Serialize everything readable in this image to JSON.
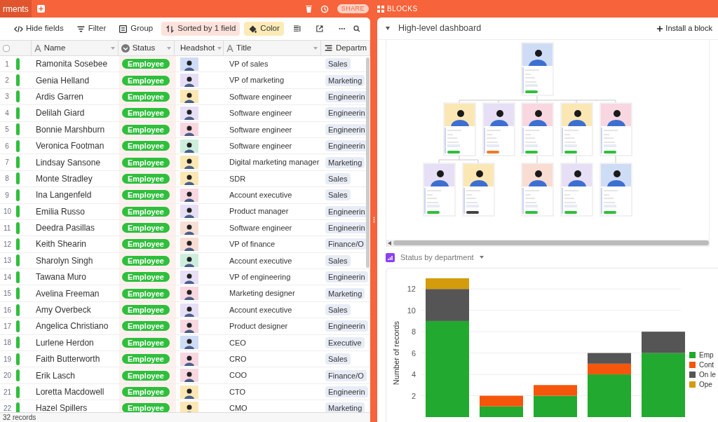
{
  "top_bar": {
    "tab_label": "rments",
    "blocks_label": "BLOCKS",
    "share_label": "SHARE"
  },
  "toolbar": {
    "items": [
      {
        "kind": "hide",
        "label": "Hide fields",
        "active": false
      },
      {
        "kind": "filter",
        "label": "Filter",
        "active": false
      },
      {
        "kind": "group",
        "label": "Group",
        "active": false
      },
      {
        "kind": "sort",
        "label": "Sorted by 1 field",
        "active": true,
        "color": "#fde2dc"
      },
      {
        "kind": "color",
        "label": "Color",
        "active": true,
        "color": "#fcebb6"
      }
    ]
  },
  "table": {
    "all_selected": false,
    "columns": [
      {
        "kind": "text",
        "label": "Name"
      },
      {
        "kind": "status",
        "label": "Status"
      },
      {
        "kind": "file",
        "label": "Headshot"
      },
      {
        "kind": "text",
        "label": "Title"
      },
      {
        "kind": "list",
        "label": "Departm"
      }
    ],
    "rows": [
      {
        "number": "1",
        "color": "#2fbf3c",
        "name": "Ramonita Sosebee",
        "status": "Employee",
        "headshot": {
          "color": "#cfdcf6"
        },
        "title": "VP of sales",
        "department": "Sales"
      },
      {
        "number": "2",
        "color": "#2fbf3c",
        "name": "Genia Helland",
        "status": "Employee",
        "headshot": {
          "color": "#e6dff5"
        },
        "title": "VP of marketing",
        "department": "Marketing"
      },
      {
        "number": "3",
        "color": "#2fbf3c",
        "name": "Ardis Garren",
        "status": "Employee",
        "headshot": {
          "color": "#fbe7b4"
        },
        "title": "Software engineer",
        "department": "Engineerin"
      },
      {
        "number": "4",
        "color": "#2fbf3c",
        "name": "Delilah Giard",
        "status": "Employee",
        "headshot": {
          "color": "#e6dff5"
        },
        "title": "Software engineer",
        "department": "Engineerin"
      },
      {
        "number": "5",
        "color": "#2fbf3c",
        "name": "Bonnie Marshburn",
        "status": "Employee",
        "headshot": {
          "color": "#f8d7e0"
        },
        "title": "Software engineer",
        "department": "Engineerin"
      },
      {
        "number": "6",
        "color": "#2fbf3c",
        "name": "Veronica Footman",
        "status": "Employee",
        "headshot": {
          "color": "#cdeedd"
        },
        "title": "Software engineer",
        "department": "Engineerin"
      },
      {
        "number": "7",
        "color": "#2fbf3c",
        "name": "Lindsay Sansone",
        "status": "Employee",
        "headshot": {
          "color": "#fbe7b4"
        },
        "title": "Digital marketing manager",
        "department": "Marketing"
      },
      {
        "number": "8",
        "color": "#2fbf3c",
        "name": "Monte Stradley",
        "status": "Employee",
        "headshot": {
          "color": "#fbe7b4"
        },
        "title": "SDR",
        "department": "Sales"
      },
      {
        "number": "9",
        "color": "#2fbf3c",
        "name": "Ina Langenfeld",
        "status": "Employee",
        "headshot": {
          "color": "#f8d7e0"
        },
        "title": "Account executive",
        "department": "Sales"
      },
      {
        "number": "10",
        "color": "#2fbf3c",
        "name": "Emilia Russo",
        "status": "Employee",
        "headshot": {
          "color": "#e6dff5"
        },
        "title": "Product manager",
        "department": "Engineerin"
      },
      {
        "number": "11",
        "color": "#2fbf3c",
        "name": "Deedra Pasillas",
        "status": "Employee",
        "headshot": {
          "color": "#f6e0d6"
        },
        "title": "Software engineer",
        "department": "Engineerin"
      },
      {
        "number": "12",
        "color": "#2fbf3c",
        "name": "Keith Shearin",
        "status": "Employee",
        "headshot": {
          "color": "#f9dcd2"
        },
        "title": "VP of finance",
        "department": "Finance/O"
      },
      {
        "number": "13",
        "color": "#2fbf3c",
        "name": "Sharolyn Singh",
        "status": "Employee",
        "headshot": {
          "color": "#cdeedd"
        },
        "title": "Account executive",
        "department": "Sales"
      },
      {
        "number": "14",
        "color": "#2fbf3c",
        "name": "Tawana Muro",
        "status": "Employee",
        "headshot": {
          "color": "#e6dff5"
        },
        "title": "VP of engineering",
        "department": "Engineerin"
      },
      {
        "number": "15",
        "color": "#2fbf3c",
        "name": "Avelina Freeman",
        "status": "Employee",
        "headshot": {
          "color": "#f8d7e0"
        },
        "title": "Marketing designer",
        "department": "Marketing"
      },
      {
        "number": "16",
        "color": "#2fbf3c",
        "name": "Amy Overbeck",
        "status": "Employee",
        "headshot": {
          "color": "#e6dff5"
        },
        "title": "Account executive",
        "department": "Sales"
      },
      {
        "number": "17",
        "color": "#2fbf3c",
        "name": "Angelica Christiano",
        "status": "Employee",
        "headshot": {
          "color": "#f8d7e0"
        },
        "title": "Product designer",
        "department": "Engineerin"
      },
      {
        "number": "18",
        "color": "#2fbf3c",
        "name": "Lurlene Herdon",
        "status": "Employee",
        "headshot": {
          "color": "#cfdcf6"
        },
        "title": "CEO",
        "department": "Executive"
      },
      {
        "number": "19",
        "color": "#2fbf3c",
        "name": "Faith Butterworth",
        "status": "Employee",
        "headshot": {
          "color": "#f8d7e0"
        },
        "title": "CRO",
        "department": "Sales"
      },
      {
        "number": "20",
        "color": "#2fbf3c",
        "name": "Erik Lasch",
        "status": "Employee",
        "headshot": {
          "color": "#f8d7e0"
        },
        "title": "COO",
        "department": "Finance/O"
      },
      {
        "number": "21",
        "color": "#2fbf3c",
        "name": "Loretta Macdowell",
        "status": "Employee",
        "headshot": {
          "color": "#fbe7b4"
        },
        "title": "CTO",
        "department": "Engineerin"
      },
      {
        "number": "22",
        "color": "#2fbf3c",
        "name": "Hazel Spillers",
        "status": "Employee",
        "headshot": {
          "color": "#fbe7b4"
        },
        "title": "CMO",
        "department": "Marketing"
      }
    ],
    "footer": "32 records"
  },
  "dashboard": {
    "title": "High-level dashboard",
    "install_label": "Install a block",
    "chart_block": {
      "title": "Status by department",
      "chart_data": {
        "type": "bar",
        "stacked": true,
        "grid": true,
        "legend": true,
        "ylabel": "Number of records",
        "ylim": [
          0,
          13
        ],
        "yticks": [
          2,
          4,
          6,
          8,
          10,
          12
        ],
        "series": [
          {
            "name": "Emp",
            "color": "#22a92f",
            "values": [
              9,
              1,
              2,
              4,
              6
            ]
          },
          {
            "name": "Cont",
            "color": "#f4560b",
            "values": [
              0,
              1,
              1,
              1,
              0
            ]
          },
          {
            "name": "On le",
            "color": "#555555",
            "values": [
              3,
              0,
              0,
              1,
              2
            ]
          },
          {
            "name": "Ope",
            "color": "#d49c0c",
            "values": [
              1,
              0,
              0,
              0,
              0
            ]
          }
        ]
      }
    }
  }
}
